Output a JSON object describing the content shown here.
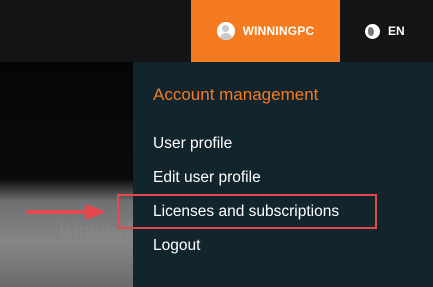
{
  "topbar": {
    "account": {
      "name": "WINNINGPC",
      "icon": "user-avatar-icon"
    },
    "language": {
      "code": "EN",
      "icon": "globe-icon"
    },
    "accent_color": "#f47b20"
  },
  "menu": {
    "heading": "Account management",
    "items": [
      {
        "label": "User profile"
      },
      {
        "label": "Edit user profile"
      },
      {
        "label": "Licenses and subscriptions",
        "highlighted": true
      },
      {
        "label": "Logout"
      }
    ]
  },
  "watermark": "WinningPC",
  "annotation": {
    "highlight_color": "#e5484d"
  }
}
